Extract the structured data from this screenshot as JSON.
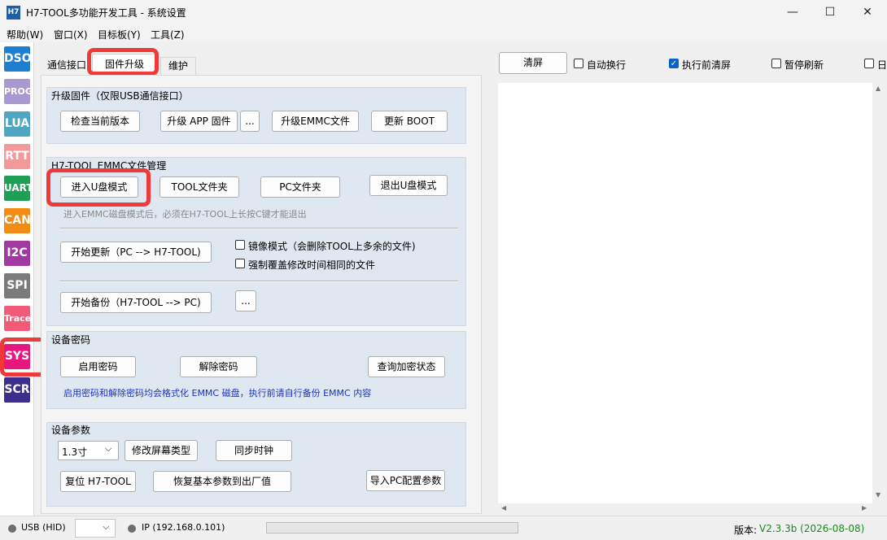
{
  "window": {
    "app_icon_text": "H7",
    "title": "H7-TOOL多功能开发工具 - 系统设置",
    "minimize_glyph": "—",
    "maximize_glyph": "☐",
    "close_glyph": "✕"
  },
  "menu": [
    "帮助(W)",
    "窗口(X)",
    "目标板(Y)",
    "工具(Z)"
  ],
  "nav": [
    {
      "label": "DSO",
      "color": "#1f7fcf"
    },
    {
      "label": "PROG",
      "color": "#a89ad0"
    },
    {
      "label": "LUA",
      "color": "#4fa6c4"
    },
    {
      "label": "RTT",
      "color": "#f29a9a"
    },
    {
      "label": "UART",
      "color": "#1f9e56"
    },
    {
      "label": "CAN",
      "color": "#f28c14"
    },
    {
      "label": "I2C",
      "color": "#9e3aa0"
    },
    {
      "label": "SPI",
      "color": "#7b7b7b"
    },
    {
      "label": "Trace",
      "color": "#f05c78"
    },
    {
      "label": "SYS",
      "color": "#e8177f"
    },
    {
      "label": "SCR",
      "color": "#3a2f8c"
    }
  ],
  "tabs": [
    "通信接口",
    "固件升级",
    "维护"
  ],
  "firmware": {
    "title": "升级固件（仅限USB通信接口）",
    "check_version": "检查当前版本",
    "upgrade_app": "升级 APP 固件",
    "ellipsis": "...",
    "upgrade_emmc": "升级EMMC文件",
    "update_boot": "更新 BOOT"
  },
  "emmc": {
    "title": "H7-TOOL EMMC文件管理",
    "enter_udisk": "进入U盘模式",
    "tool_folder": "TOOL文件夹",
    "pc_folder": "PC文件夹",
    "exit_udisk": "退出U盘模式",
    "hint": "进入EMMC磁盘模式后，必须在H7-TOOL上长按C键才能退出",
    "start_update": "开始更新（PC --> H7-TOOL)",
    "mirror_mode": "镜像模式（会删除TOOL上多余的文件)",
    "force_overwrite": "强制覆盖修改时间相同的文件",
    "start_backup": "开始备份（H7-TOOL --> PC)",
    "ellipsis": "..."
  },
  "password": {
    "title": "设备密码",
    "enable": "启用密码",
    "disable": "解除密码",
    "query": "查询加密状态",
    "warning": "启用密码和解除密码均会格式化 EMMC 磁盘，执行前请自行备份 EMMC 内容"
  },
  "params": {
    "title": "设备参数",
    "screen_size": "1.3寸",
    "change_screen": "修改屏幕类型",
    "sync_clock": "同步时钟",
    "reset": "复位 H7-TOOL",
    "restore_defaults": "恢复基本参数到出厂值",
    "import_pc": "导入PC配置参数"
  },
  "output": {
    "clear": "清屏",
    "auto_wrap": "自动换行",
    "auto_wrap_checked": false,
    "clear_before_exec": "执行前清屏",
    "clear_before_exec_checked": true,
    "pause_refresh": "暂停刷新",
    "pause_refresh_checked": false,
    "log_partial": "日"
  },
  "status": {
    "usb": "USB (HID)",
    "ip": "IP (192.168.0.101)",
    "version_label": "版本:",
    "version_value": "V2.3.3b (2026-08-08)",
    "version_color": "#1a8a1a"
  }
}
